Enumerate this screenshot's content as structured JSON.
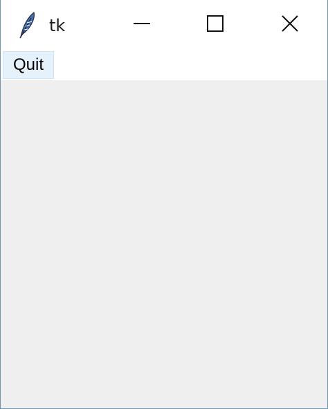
{
  "window": {
    "title": "tk",
    "icon": "feather-icon",
    "controls": {
      "minimize": "minimize-icon",
      "maximize": "maximize-icon",
      "close": "close-icon"
    }
  },
  "menubar": {
    "items": [
      {
        "label": "Quit"
      }
    ]
  },
  "colors": {
    "border": "#6f96ad",
    "client_background": "#efefef",
    "menu_highlight": "#e5f1fb",
    "menu_highlight_border": "#cce4f7"
  }
}
